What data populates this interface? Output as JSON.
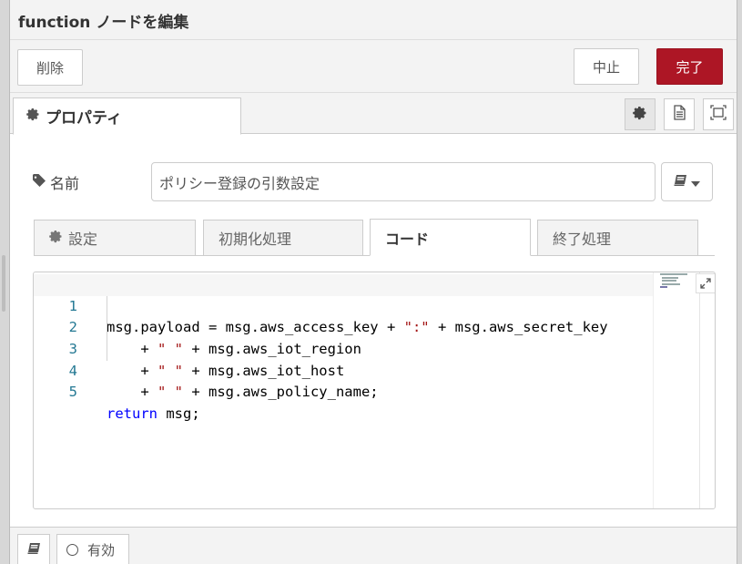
{
  "header": {
    "title": "function ノードを編集"
  },
  "actions": {
    "delete_label": "削除",
    "cancel_label": "中止",
    "done_label": "完了"
  },
  "tabs": {
    "properties_label": "プロパティ"
  },
  "form": {
    "name_label": "名前",
    "name_value": "ポリシー登録の引数設定"
  },
  "subtabs": [
    {
      "label": "設定"
    },
    {
      "label": "初期化処理"
    },
    {
      "label": "コード"
    },
    {
      "label": "終了処理"
    }
  ],
  "editor": {
    "line_numbers": [
      "1",
      "2",
      "3",
      "4",
      "5"
    ],
    "code": [
      "msg.payload = msg.aws_access_key + \":\" + msg.aws_secret_key",
      "    + \" \" + msg.aws_iot_region",
      "    + \" \" + msg.aws_iot_host",
      "    + \" \" + msg.aws_policy_name;",
      "return msg;"
    ]
  },
  "footer": {
    "enabled_label": "有効"
  },
  "colors": {
    "done_button": "#ad1625",
    "keyword": "#0000ff",
    "string": "#a31515",
    "line_number": "#237893"
  },
  "icons": [
    "gear-icon",
    "document-icon",
    "frame-icon",
    "tag-icon",
    "book-icon",
    "caret-down-icon",
    "expand-icon",
    "circle-icon"
  ]
}
